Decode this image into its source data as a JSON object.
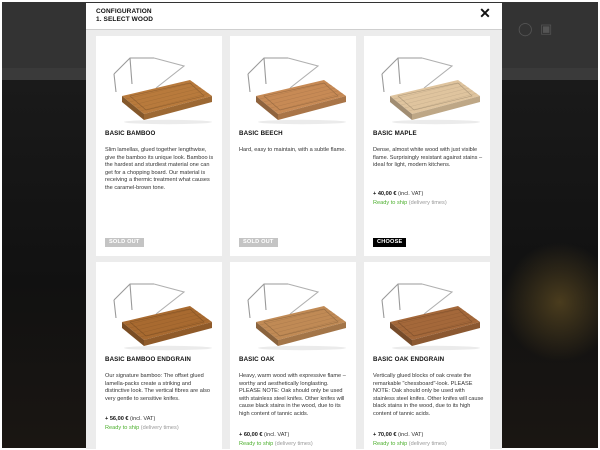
{
  "modal": {
    "step_label": "CONFIGURATION",
    "step_title": "1. SELECT WOOD",
    "close_symbol": "✕"
  },
  "background": {
    "user_icon": "user-icon",
    "cart_icon": "cart-icon"
  },
  "colors": {
    "ready_green": "#4caf2d",
    "choose_bg": "#000000",
    "sold_out_bg": "#c4c4c4"
  },
  "products": [
    {
      "title": "BASIC BAMBOO",
      "description": "Slim lamellas, glued together lengthwise, give the bamboo its unique look. Bamboo is the hardest and sturdiest material one can get for a chopping board. Our material is receiving a thermic treatment what causes the caramel-brown tone.",
      "price": "",
      "price_note": "",
      "availability": "",
      "delivery_link": "",
      "button": "SOLD OUT",
      "wood_color": "#b87a3c"
    },
    {
      "title": "BASIC BEECH",
      "description": "Hard, easy to maintain, with a subtle flame.",
      "price": "",
      "price_note": "",
      "availability": "",
      "delivery_link": "",
      "button": "SOLD OUT",
      "wood_color": "#c78a55"
    },
    {
      "title": "BASIC MAPLE",
      "description": "Dense, almost white wood with just visible flame. Surprisingly resistant against stains – ideal for light, modern kitchens.",
      "price": "+ 40,00 €",
      "price_note": "(incl. VAT)",
      "availability": "Ready to ship",
      "delivery_link": "(delivery times)",
      "button": "CHOOSE",
      "wood_color": "#dfc49e"
    },
    {
      "title": "BASIC BAMBOO ENDGRAIN",
      "description": "Our signature bamboo: The offset glued lamella-packs create a striking and distinctive look. The vertical fibres are also very gentle to sensitive knifes.",
      "price": "+ 56,00 €",
      "price_note": "(incl. VAT)",
      "availability": "Ready to ship",
      "delivery_link": "(delivery times)",
      "button": "",
      "wood_color": "#a86a30"
    },
    {
      "title": "BASIC OAK",
      "description": "Heavy, warm wood with expressive flame – worthy and aesthetically longlasting. PLEASE NOTE: Oak should only be used with stainless steel knifes. Other knifes will cause black stains in the wood, due to its high content of tannic acids.",
      "price": "+ 60,00 €",
      "price_note": "(incl. VAT)",
      "availability": "Ready to ship",
      "delivery_link": "(delivery times)",
      "button": "",
      "wood_color": "#c08a55"
    },
    {
      "title": "BASIC OAK ENDGRAIN",
      "description": "Vertically glued blocks of oak create the remarkable \"chessboard\"-look. PLEASE NOTE: Oak should only be used with stainless steel knifes. Other knifes will cause black stains in the wood, due to its high content of tannic acids.",
      "price": "+ 70,00 €",
      "price_note": "(incl. VAT)",
      "availability": "Ready to ship",
      "delivery_link": "(delivery times)",
      "button": "",
      "wood_color": "#a4683a"
    }
  ]
}
